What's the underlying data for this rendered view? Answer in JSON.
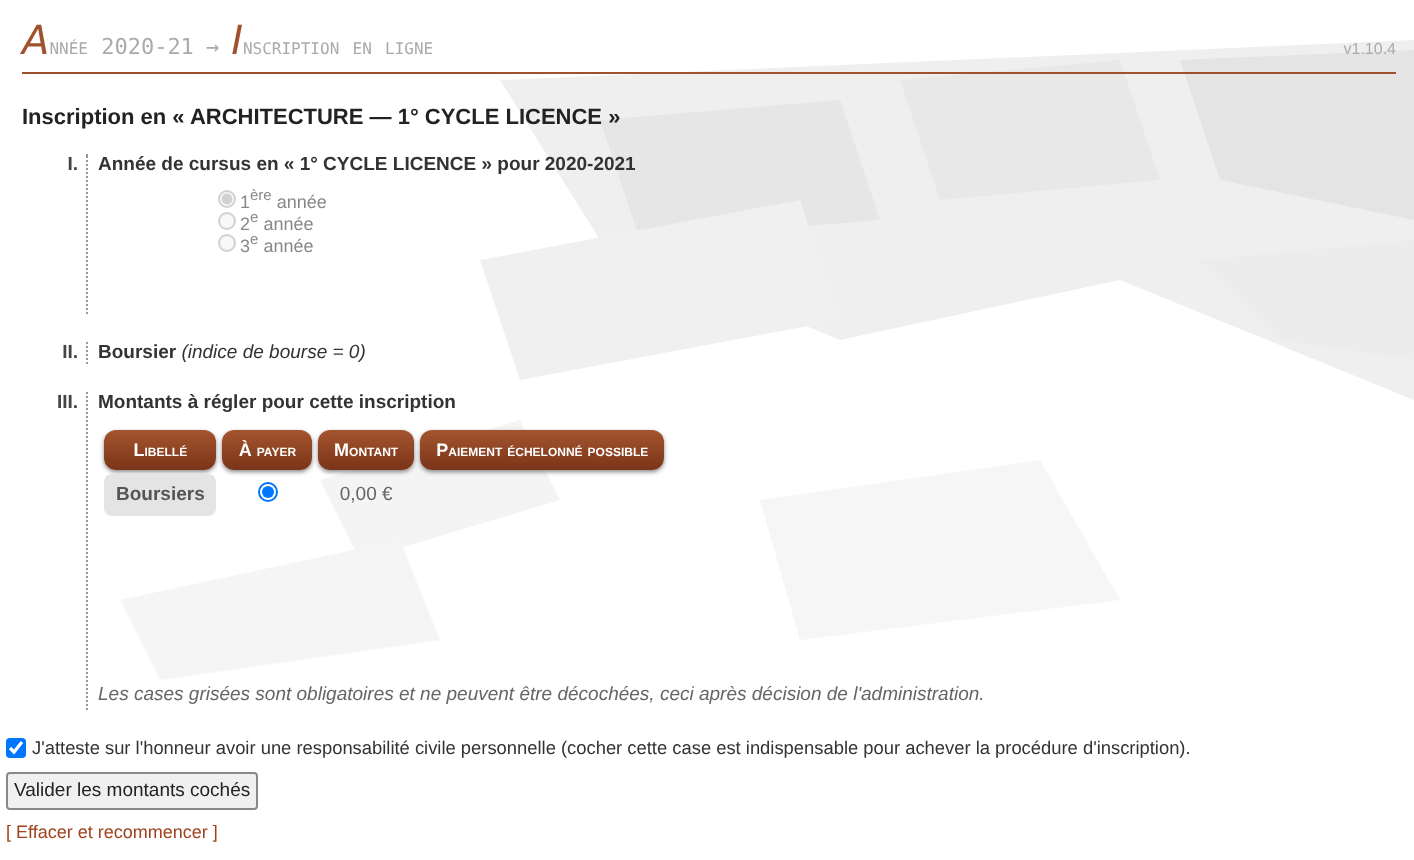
{
  "header": {
    "year": "Année 2020-21",
    "arrow": "→",
    "page": "Inscription en ligne",
    "version": "v1.10.4"
  },
  "heading": "Inscription en « ARCHITECTURE — 1° CYCLE LICENCE »",
  "sections": [
    {
      "number": "I.",
      "kind": "radios",
      "title": "Année de cursus en « 1° CYCLE LICENCE » pour 2020-2021",
      "options": [
        {
          "label": "1$^{ère}$ année",
          "selected": true,
          "disabled": true
        },
        {
          "label": "2$^{e}$ année",
          "selected": false,
          "disabled": true
        },
        {
          "label": "3$^{e}$ année",
          "selected": false,
          "disabled": true
        }
      ]
    },
    {
      "number": "II.",
      "kind": "text",
      "title": "**Boursier** *(indice de bourse = 0)*"
    },
    {
      "number": "III.",
      "kind": "table",
      "title": "Montants à régler pour cette inscription",
      "columns": [
        "Libellé",
        "À payer",
        "Montant",
        "Paiement échelonné possible"
      ],
      "rows": [
        {
          "label": "Boursiers",
          "selected": true,
          "amount": "0,00 €"
        }
      ],
      "note": "Les cases grisées sont obligatoires et ne peuvent être décochées, ceci après décision de l'administration."
    }
  ],
  "attestation": {
    "label": "J'atteste sur l'honneur avoir une responsabilité civile personnelle (cocher cette case est indispensable pour achever la procédure d'inscription).",
    "checked": true
  },
  "submit": "Valider les montants cochés",
  "reset_link": "[ Effacer et recommencer ]"
}
